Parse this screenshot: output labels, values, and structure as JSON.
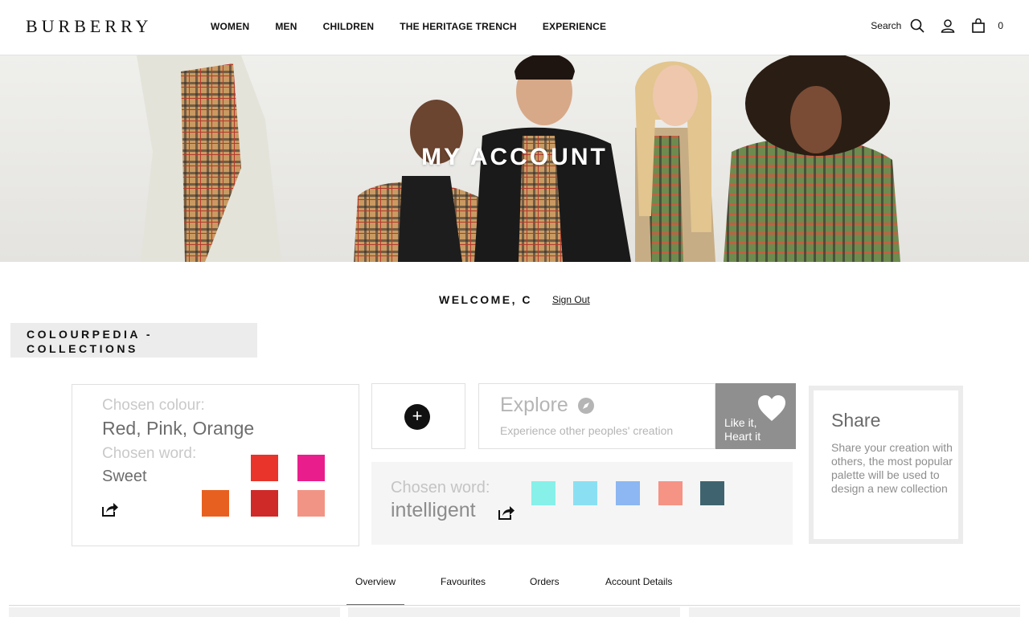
{
  "header": {
    "logo": "BURBERRY",
    "nav": [
      "WOMEN",
      "MEN",
      "CHILDREN",
      "THE HERITAGE TRENCH",
      "EXPERIENCE"
    ],
    "search_label": "Search",
    "bag_count": "0",
    "icons": [
      "search-icon",
      "account-icon",
      "bag-icon"
    ]
  },
  "hero": {
    "title": "MY ACCOUNT"
  },
  "welcome": {
    "text": "WELCOME, C",
    "signout": "Sign Out"
  },
  "section_label": "COLOURPEDIA - COLLECTIONS",
  "card1": {
    "colour_label": "Chosen colour:",
    "colour_value": "Red, Pink, Orange",
    "word_label": "Chosen word:",
    "word_value": "Sweet",
    "swatches": [
      "#e8342a",
      "#e91e8c",
      "#e8601f",
      "#cf2a27",
      "#f29485"
    ]
  },
  "explore": {
    "title": "Explore",
    "subtitle": "Experience other peoples' creation",
    "like_line1": "Like it,",
    "like_line2": "Heart it"
  },
  "card2": {
    "word_label": "Chosen word:",
    "word_value": "intelligent",
    "swatches": [
      "#86f0e9",
      "#8ae0f2",
      "#8cb7f2",
      "#f59385",
      "#3f6470"
    ]
  },
  "share": {
    "title": "Share",
    "description": "Share your creation with others, the most popular palette will be used to design a new collection"
  },
  "tabs": [
    "Overview",
    "Favourites",
    "Orders",
    "Account Details"
  ],
  "active_tab": "Overview"
}
